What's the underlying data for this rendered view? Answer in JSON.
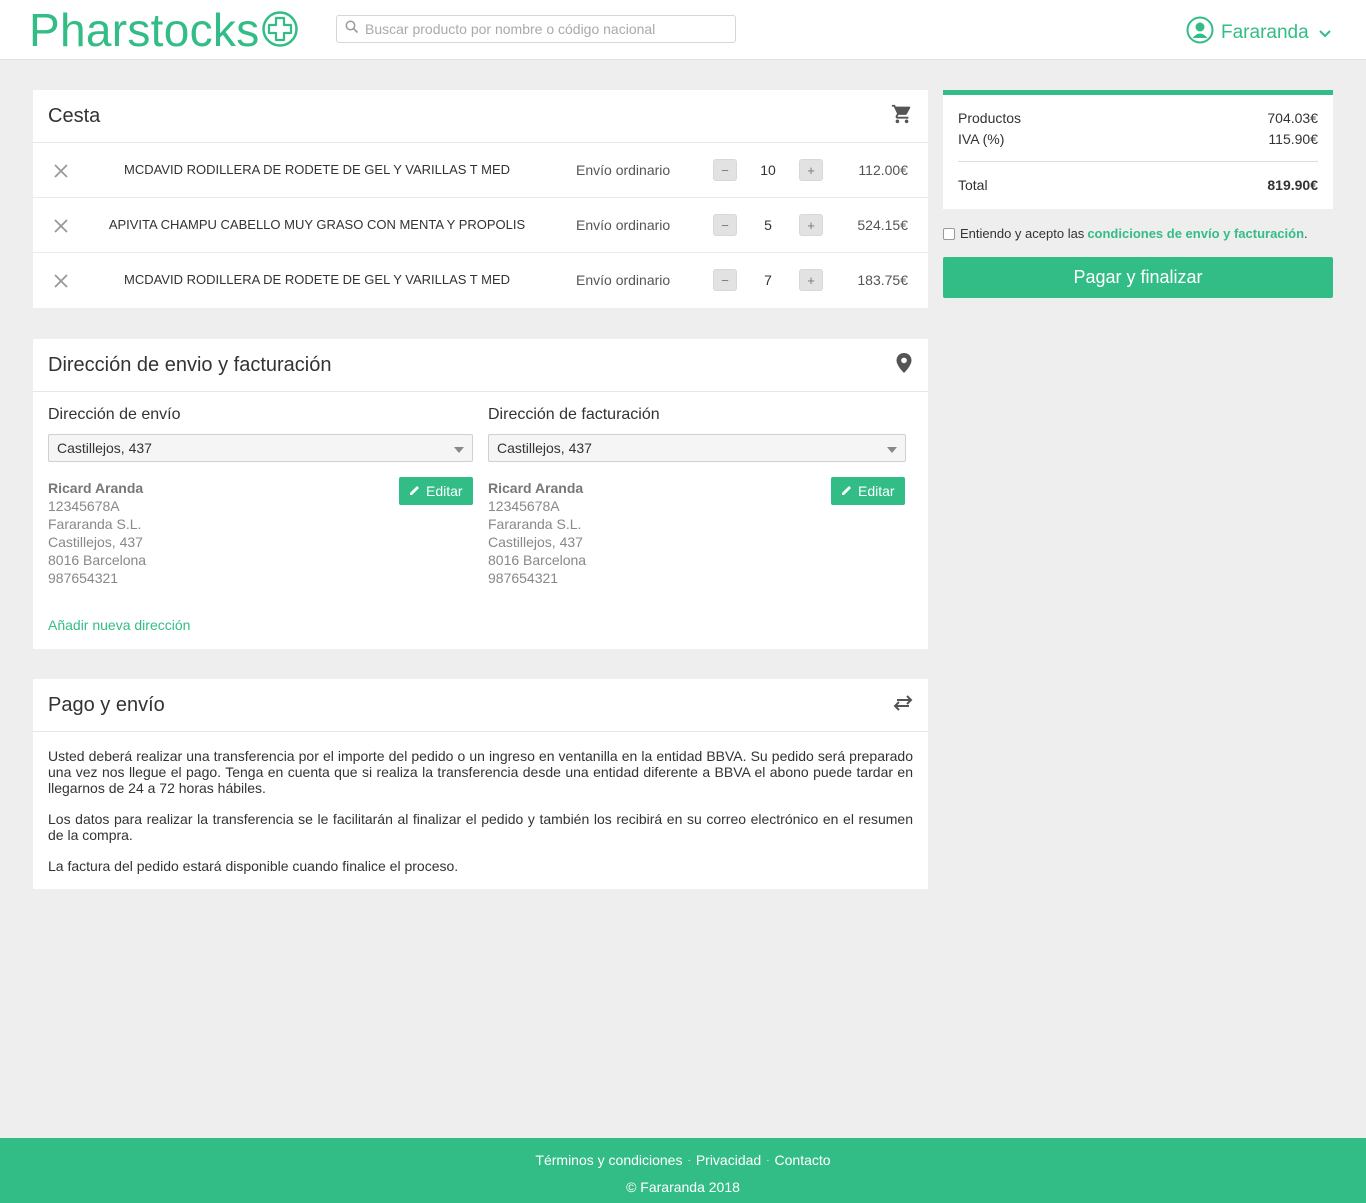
{
  "brand": {
    "name": "Pharstocks",
    "accent": "#33bd86"
  },
  "search": {
    "placeholder": "Buscar producto por nombre o código nacional"
  },
  "user": {
    "name": "Fararanda"
  },
  "cart": {
    "title": "Cesta",
    "items": [
      {
        "name": "MCDAVID RODILLERA DE RODETE DE GEL Y VARILLAS T MED",
        "shipping": "Envío ordinario",
        "quantity": "10",
        "price": "112.00€"
      },
      {
        "name": "APIVITA CHAMPU CABELLO MUY GRASO CON MENTA Y PROPOLIS",
        "shipping": "Envío ordinario",
        "quantity": "5",
        "price": "524.15€"
      },
      {
        "name": "MCDAVID RODILLERA DE RODETE DE GEL Y VARILLAS T MED",
        "shipping": "Envío ordinario",
        "quantity": "7",
        "price": "183.75€"
      }
    ],
    "minus": "−",
    "plus": "+"
  },
  "address": {
    "title": "Dirección de envio y facturación",
    "shipping": {
      "label": "Dirección de envío",
      "selected": "Castillejos, 437",
      "name": "Ricard Aranda",
      "nif": "12345678A",
      "company": "Fararanda S.L.",
      "street": "Castillejos, 437",
      "city": "8016 Barcelona",
      "phone": "987654321",
      "edit": "Editar"
    },
    "billing": {
      "label": "Dirección de facturación",
      "selected": "Castillejos, 437",
      "name": "Ricard Aranda",
      "nif": "12345678A",
      "company": "Fararanda S.L.",
      "street": "Castillejos, 437",
      "city": "8016 Barcelona",
      "phone": "987654321",
      "edit": "Editar"
    },
    "add_new": "Añadir nueva dirección"
  },
  "payment": {
    "title": "Pago y envío",
    "paragraphs": [
      "Usted deberá realizar una transferencia por el importe del pedido o un ingreso en ventanilla en la entidad BBVA. Su pedido será preparado una vez nos llegue el pago. Tenga en cuenta que si realiza la transferencia desde una entidad diferente a BBVA el abono puede tardar en llegarnos de 24 a 72 horas hábiles.",
      "Los datos para realizar la transferencia se le facilitarán al finalizar el pedido y también los recibirá en su correo electrónico en el resumen de la compra.",
      "La factura del pedido estará disponible cuando finalice el proceso."
    ]
  },
  "summary": {
    "products_label": "Productos",
    "products_value": "704.03€",
    "vat_label": "IVA (%)",
    "vat_value": "115.90€",
    "total_label": "Total",
    "total_value": "819.90€"
  },
  "terms": {
    "prefix": "Entiendo y acepto las",
    "link": "condiciones de envío y facturación",
    "suffix": "."
  },
  "checkout": {
    "button": "Pagar y finalizar"
  },
  "footer": {
    "links": [
      "Términos y condiciones",
      "Privacidad",
      "Contacto"
    ],
    "copyright": "© Fararanda 2018"
  }
}
